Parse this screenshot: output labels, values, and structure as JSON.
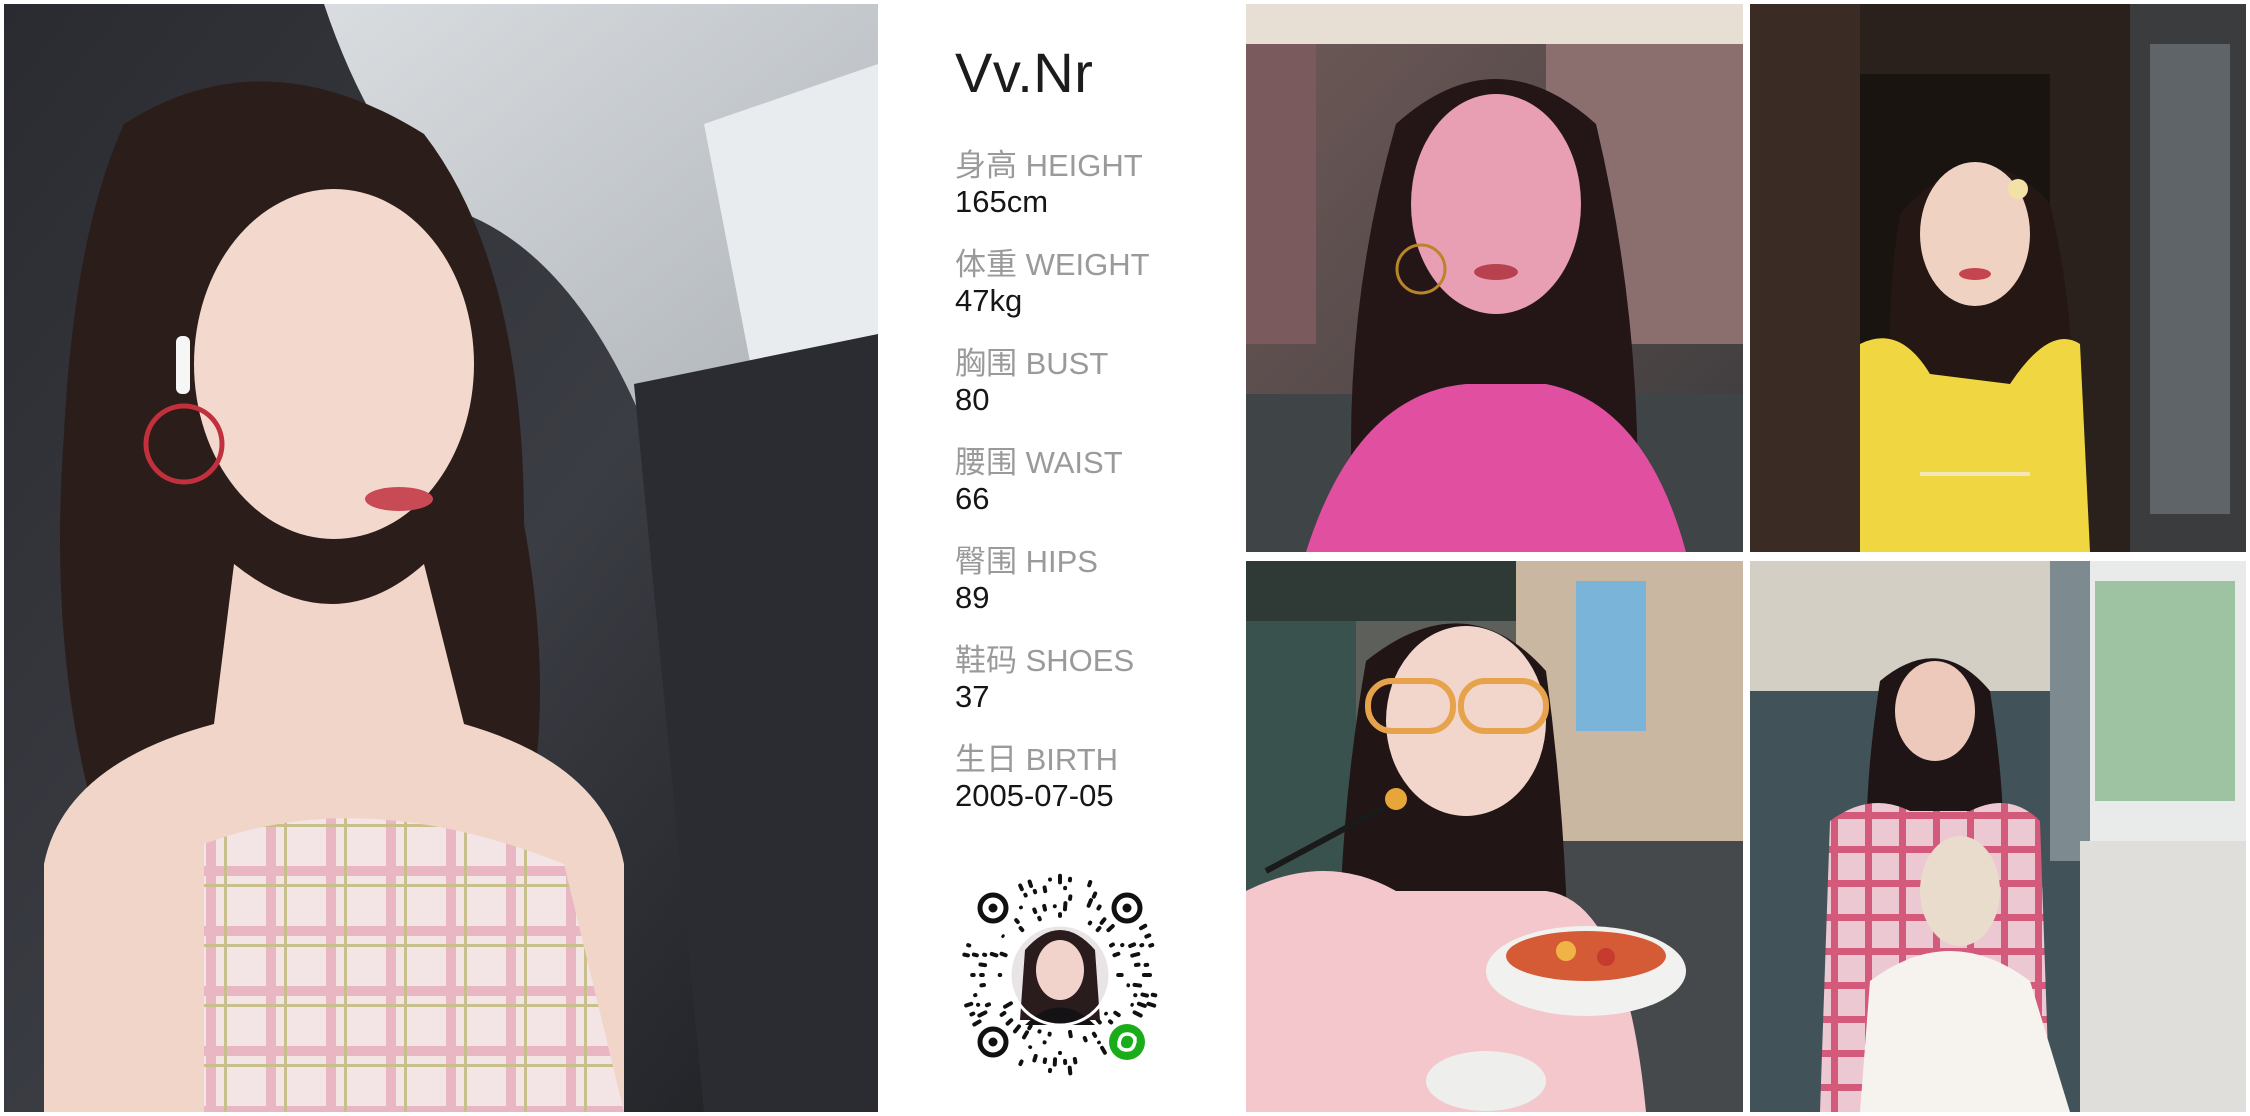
{
  "profile": {
    "name": "Vv.Nr",
    "stats": [
      {
        "label": "身高 HEIGHT",
        "value": "165cm"
      },
      {
        "label": "体重 WEIGHT",
        "value": "47kg"
      },
      {
        "label": "胸围 BUST",
        "value": "80"
      },
      {
        "label": "腰围 WAIST",
        "value": "66"
      },
      {
        "label": "臀围 HIPS",
        "value": "89"
      },
      {
        "label": "鞋码 SHOES",
        "value": "37"
      },
      {
        "label": "生日 BIRTH",
        "value": "2005-07-05"
      }
    ]
  },
  "qr_code": {
    "icon": "mini-program-link-icon",
    "accent": "#1aad19"
  },
  "photos": [
    {
      "name": "main-portrait-car"
    },
    {
      "name": "portrait-pink-light"
    },
    {
      "name": "portrait-yellow-dress"
    },
    {
      "name": "portrait-glasses-restaurant"
    },
    {
      "name": "portrait-plaid-shirt-window"
    }
  ]
}
